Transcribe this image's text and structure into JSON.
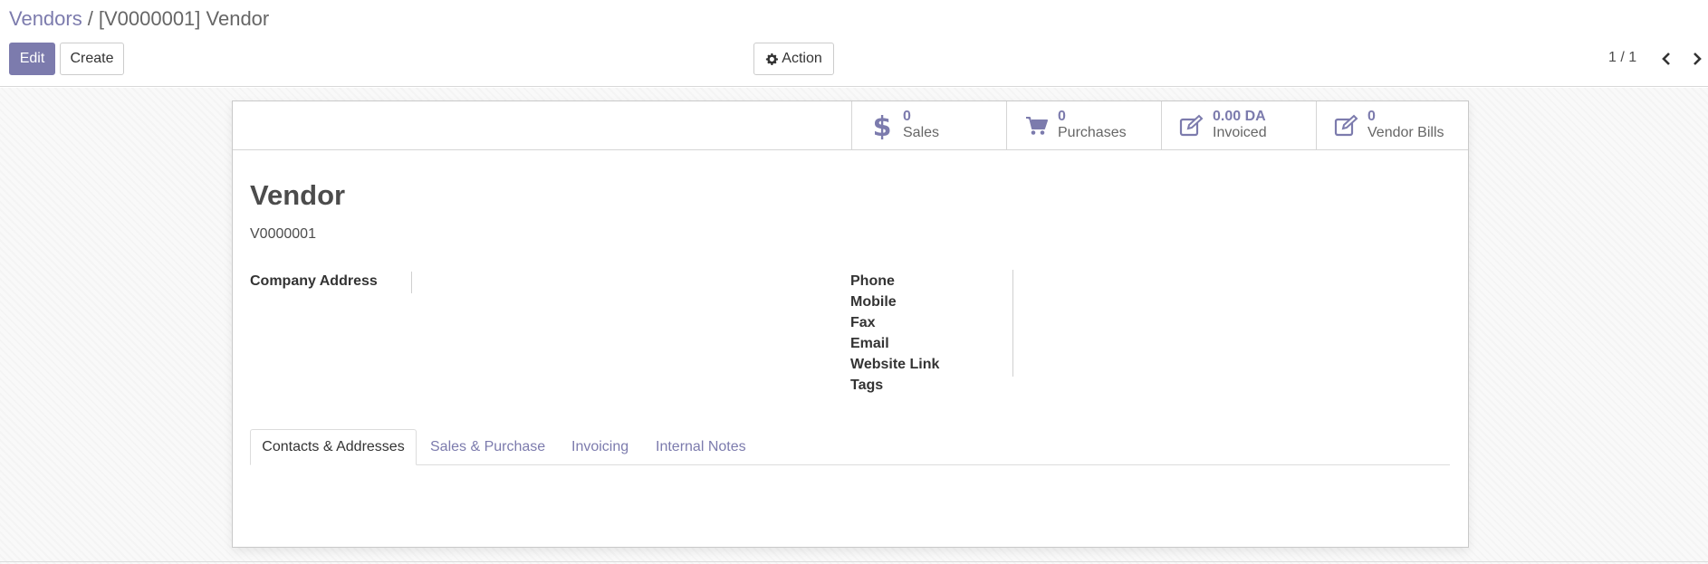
{
  "breadcrumb": {
    "parent": "Vendors",
    "separator": "/",
    "current": "[V0000001] Vendor"
  },
  "toolbar": {
    "edit_label": "Edit",
    "create_label": "Create",
    "action_label": "Action",
    "action_icon": "gear-icon"
  },
  "pager": {
    "value": "1 / 1",
    "prev_icon": "chevron-left-icon",
    "next_icon": "chevron-right-icon"
  },
  "smart_buttons": [
    {
      "value": "0",
      "label": "Sales",
      "icon": "dollar-icon"
    },
    {
      "value": "0",
      "label": "Purchases",
      "icon": "cart-icon"
    },
    {
      "value": "0.00 DA",
      "label": "Invoiced",
      "icon": "edit-icon"
    },
    {
      "value": "0",
      "label": "Vendor Bills",
      "icon": "edit-icon"
    }
  ],
  "record": {
    "name": "Vendor",
    "reference": "V0000001"
  },
  "fields": {
    "company_address": "Company Address",
    "phone": "Phone",
    "mobile": "Mobile",
    "fax": "Fax",
    "email": "Email",
    "website": "Website Link",
    "tags": "Tags"
  },
  "tabs": [
    {
      "label": "Contacts & Addresses",
      "active": true
    },
    {
      "label": "Sales & Purchase",
      "active": false
    },
    {
      "label": "Invoicing",
      "active": false
    },
    {
      "label": "Internal Notes",
      "active": false
    }
  ],
  "colors": {
    "accent": "#7c7bad",
    "text": "#4c4c4c",
    "muted": "#666666",
    "border": "#d5d5d5"
  }
}
